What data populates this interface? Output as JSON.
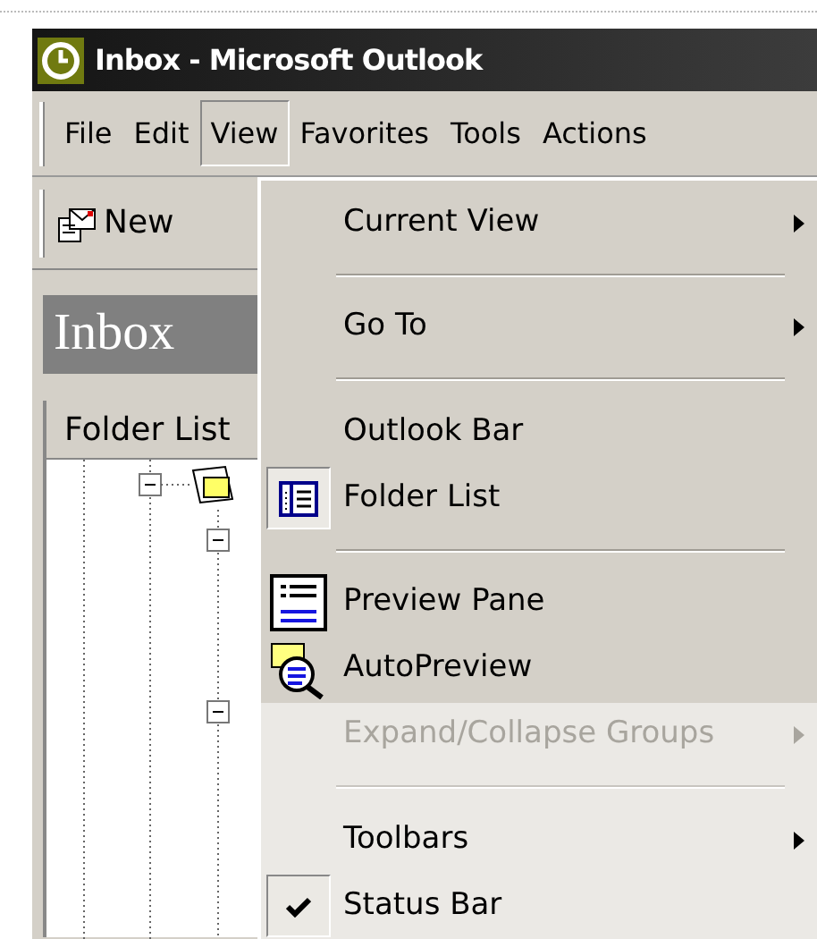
{
  "window": {
    "title": "Inbox - Microsoft Outlook"
  },
  "menu_bar": [
    {
      "label": "File",
      "selected": false
    },
    {
      "label": "Edit",
      "selected": false
    },
    {
      "label": "View",
      "selected": true
    },
    {
      "label": "Favorites",
      "selected": false
    },
    {
      "label": "Tools",
      "selected": false
    },
    {
      "label": "Actions",
      "selected": false
    }
  ],
  "toolbar": {
    "new_button": {
      "label": "New"
    }
  },
  "folder_banner": {
    "title": "Inbox"
  },
  "folder_pane": {
    "header": "Folder List"
  },
  "view_menu": [
    {
      "kind": "item",
      "label": "Current View",
      "submenu": true,
      "checked": false,
      "disabled": false,
      "recent": true
    },
    {
      "kind": "separator",
      "recent": true
    },
    {
      "kind": "item",
      "label": "Go To",
      "submenu": true,
      "checked": false,
      "disabled": false,
      "recent": true
    },
    {
      "kind": "separator",
      "recent": true
    },
    {
      "kind": "item",
      "label": "Outlook Bar",
      "submenu": false,
      "checked": false,
      "disabled": false,
      "recent": true
    },
    {
      "kind": "item",
      "label": "Folder List",
      "submenu": false,
      "checked": true,
      "disabled": false,
      "recent": true
    },
    {
      "kind": "separator",
      "recent": true
    },
    {
      "kind": "item",
      "label": "Preview Pane",
      "submenu": false,
      "checked": false,
      "disabled": false,
      "recent": true
    },
    {
      "kind": "item",
      "label": "AutoPreview",
      "submenu": false,
      "checked": false,
      "disabled": false,
      "recent": true
    },
    {
      "kind": "item",
      "label": "Expand/Collapse Groups",
      "submenu": true,
      "checked": false,
      "disabled": true,
      "recent": false
    },
    {
      "kind": "separator",
      "recent": false
    },
    {
      "kind": "item",
      "label": "Toolbars",
      "submenu": true,
      "checked": false,
      "disabled": false,
      "recent": false
    },
    {
      "kind": "item",
      "label": "Status Bar",
      "submenu": false,
      "checked": true,
      "disabled": false,
      "recent": false
    }
  ]
}
